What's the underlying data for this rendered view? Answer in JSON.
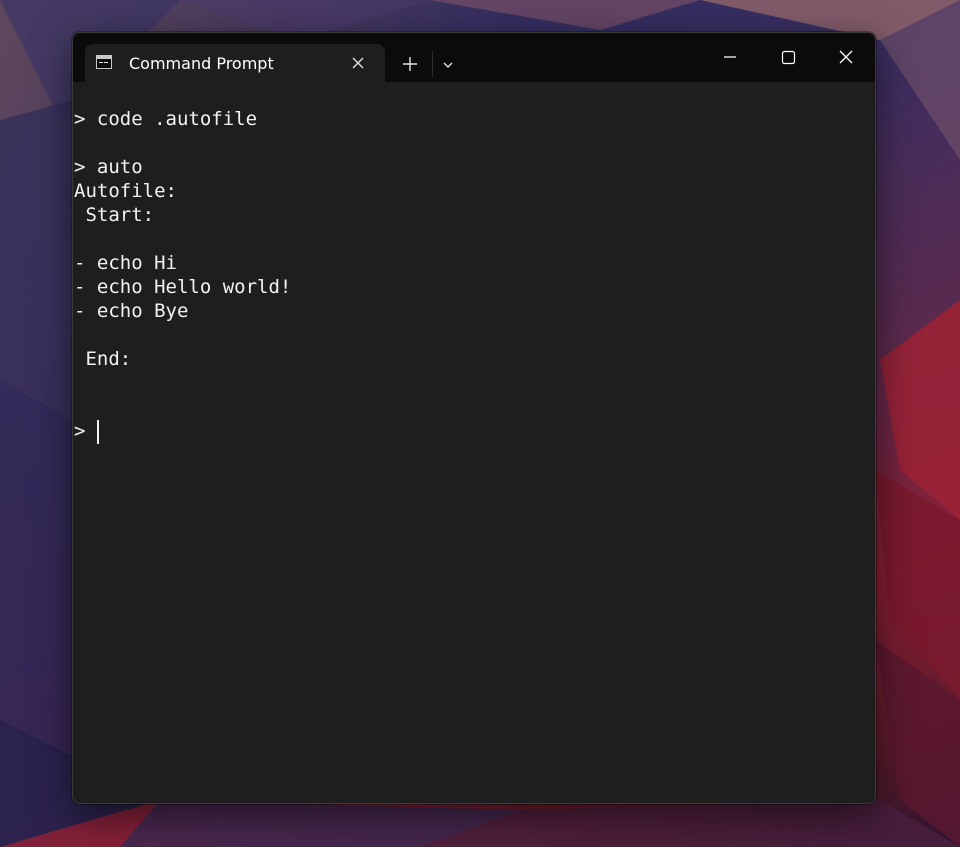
{
  "window": {
    "tab_title": "Command Prompt",
    "icons": {
      "tab": "command-prompt-icon",
      "tab_close": "close-icon",
      "new_tab": "plus-icon",
      "dropdown": "chevron-down-icon",
      "minimize": "minimize-icon",
      "maximize": "maximize-icon",
      "close": "close-icon"
    }
  },
  "terminal": {
    "lines": [
      "> code .autofile",
      "",
      "> auto",
      "Autofile:",
      " Start:",
      "",
      "- echo Hi",
      "- echo Hello world!",
      "- echo Bye",
      "",
      " End:",
      "",
      "",
      "> "
    ],
    "colors": {
      "background": "#1e1e1e",
      "foreground": "#f2f2f2",
      "titlebar": "#0b0b0b"
    }
  }
}
